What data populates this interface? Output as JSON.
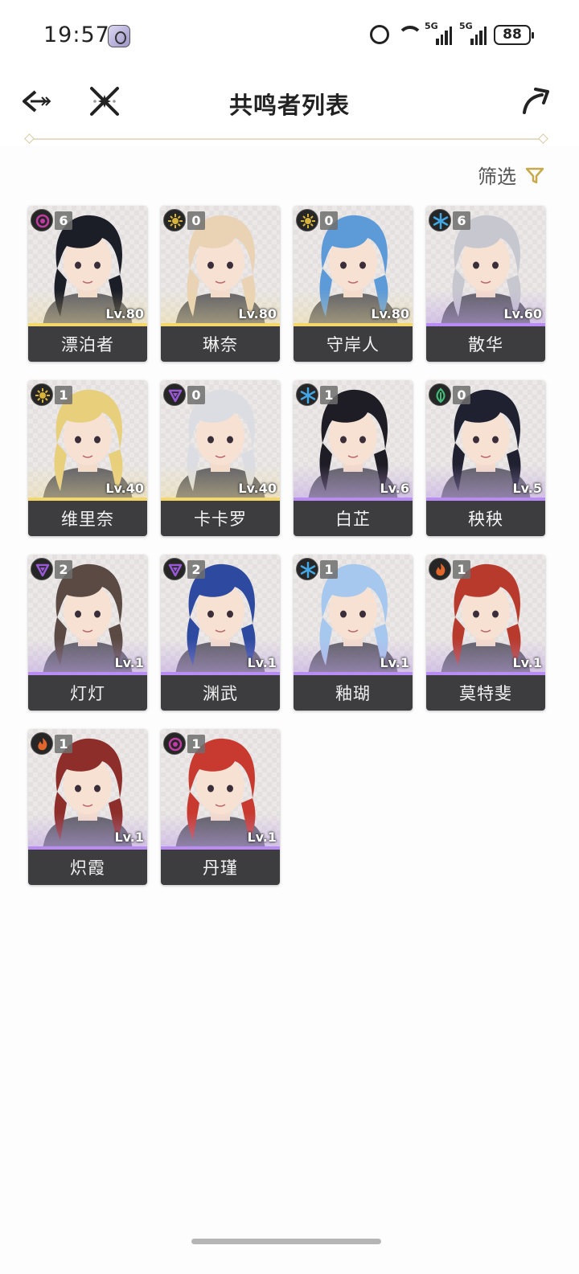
{
  "status_bar": {
    "time": "19:57",
    "signal_label_1": "5G",
    "signal_label_2": "5G",
    "battery": "88"
  },
  "header": {
    "title": "共鸣者列表"
  },
  "filter": {
    "label": "筛选"
  },
  "colors": {
    "rarity_gold": "#f3d76a",
    "rarity_purple": "#b88cf2",
    "name_bar": "#3d3d3f",
    "accent": "#c8a94a"
  },
  "characters": [
    {
      "name": "漂泊者",
      "level": "Lv.80",
      "sequence": "6",
      "element": "havoc-icon",
      "element_color": "#c13ba4",
      "rarity": "gold",
      "hair": "#1b1d27"
    },
    {
      "name": "琳奈",
      "level": "Lv.80",
      "sequence": "0",
      "element": "spectro-icon",
      "element_color": "#d8b33a",
      "rarity": "gold",
      "hair": "#e9d3b4"
    },
    {
      "name": "守岸人",
      "level": "Lv.80",
      "sequence": "0",
      "element": "spectro-icon",
      "element_color": "#d8b33a",
      "rarity": "gold",
      "hair": "#5d9ad8"
    },
    {
      "name": "散华",
      "level": "Lv.60",
      "sequence": "6",
      "element": "glacio-icon",
      "element_color": "#43a7e6",
      "rarity": "purple",
      "hair": "#c7c7cf"
    },
    {
      "name": "维里奈",
      "level": "Lv.40",
      "sequence": "1",
      "element": "spectro-icon",
      "element_color": "#d8b33a",
      "rarity": "gold",
      "hair": "#e8cf7c"
    },
    {
      "name": "卡卡罗",
      "level": "Lv.40",
      "sequence": "0",
      "element": "electro-icon",
      "element_color": "#9a58d6",
      "rarity": "gold",
      "hair": "#dcdde2"
    },
    {
      "name": "白芷",
      "level": "Lv.6",
      "sequence": "1",
      "element": "glacio-icon",
      "element_color": "#43a7e6",
      "rarity": "purple",
      "hair": "#1e1c24"
    },
    {
      "name": "秧秧",
      "level": "Lv.5",
      "sequence": "0",
      "element": "aero-icon",
      "element_color": "#3fbf7a",
      "rarity": "purple",
      "hair": "#1f2030"
    },
    {
      "name": "灯灯",
      "level": "Lv.1",
      "sequence": "2",
      "element": "electro-icon",
      "element_color": "#9a58d6",
      "rarity": "purple",
      "hair": "#5a4a43"
    },
    {
      "name": "渊武",
      "level": "Lv.1",
      "sequence": "2",
      "element": "electro-icon",
      "element_color": "#9a58d6",
      "rarity": "purple",
      "hair": "#2e4aa0"
    },
    {
      "name": "釉瑚",
      "level": "Lv.1",
      "sequence": "1",
      "element": "glacio-icon",
      "element_color": "#43a7e6",
      "rarity": "purple",
      "hair": "#a7c8ee"
    },
    {
      "name": "莫特斐",
      "level": "Lv.1",
      "sequence": "1",
      "element": "fusion-icon",
      "element_color": "#e0662c",
      "rarity": "purple",
      "hair": "#b83a2c"
    },
    {
      "name": "炽霞",
      "level": "Lv.1",
      "sequence": "1",
      "element": "fusion-icon",
      "element_color": "#e0662c",
      "rarity": "purple",
      "hair": "#8e2e2a"
    },
    {
      "name": "丹瑾",
      "level": "Lv.1",
      "sequence": "1",
      "element": "havoc-icon",
      "element_color": "#c13ba4",
      "rarity": "purple",
      "hair": "#c83a30"
    }
  ]
}
